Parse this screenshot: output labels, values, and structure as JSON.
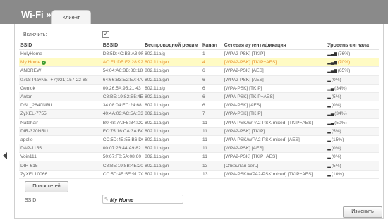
{
  "header": {
    "title": "Wi-Fi »",
    "tab": "Клиент"
  },
  "enable": {
    "label": "Включить:",
    "checked": true
  },
  "table": {
    "columns": [
      "SSID",
      "BSSID",
      "Беспроводной режим",
      "Канал",
      "Сетевая аутентификация",
      "Уровень сигнала"
    ],
    "rows": [
      {
        "ssid": "HolyHome",
        "bssid": "D8:5D:4C:B3:A3:9F",
        "mode": "802.11b/g",
        "channel": "1",
        "auth": "[WPA2-PSK] [TKIP]",
        "signal": "(76%)",
        "selected": false
      },
      {
        "ssid": "My Home",
        "bssid": "AC:F1:DF:F2:28:92",
        "mode": "802.11b/g/n",
        "channel": "4",
        "auth": "[WPA2-PSK] [TKIP+AES]",
        "signal": "(70%)",
        "selected": true
      },
      {
        "ssid": "ANDREW",
        "bssid": "54:04:A6:BB:8C:18",
        "mode": "802.11b/g/n",
        "channel": "6",
        "auth": "[WPA2-PSK] [AES]",
        "signal": "(65%)",
        "selected": false
      },
      {
        "ssid": "0798 PlayNET+7(921)157-22-88",
        "bssid": "64:66:B3:E2:E7:4A",
        "mode": "802.11b/g/n",
        "channel": "6",
        "auth": "[WPA2-PSK] [AES]",
        "signal": "(0%)",
        "selected": false
      },
      {
        "ssid": "Geniok",
        "bssid": "00:26:5A:95:21:43",
        "mode": "802.11b/g",
        "channel": "6",
        "auth": "[WPA-PSK] [TKIP]",
        "signal": "(34%)",
        "selected": false
      },
      {
        "ssid": "Anton",
        "bssid": "C8:BE:19:82:B5:4E",
        "mode": "802.11b/g/n",
        "channel": "6",
        "auth": "[WPA-PSK] [TKIP+AES]",
        "signal": "(5%)",
        "selected": false
      },
      {
        "ssid": "DSL_2640NRU",
        "bssid": "34:08:04:EC:24:68",
        "mode": "802.11b/g/n",
        "channel": "6",
        "auth": "[WPA-PSK] [AES]",
        "signal": "(0%)",
        "selected": false
      },
      {
        "ssid": "ZyXEL-7755",
        "bssid": "40:4A:03:AC:5A:B3",
        "mode": "802.11b/g/n",
        "channel": "7",
        "auth": "[WPA-PSK] [TKIP]",
        "signal": "(34%)",
        "selected": false
      },
      {
        "ssid": "Natahair",
        "bssid": "B0:48:7A:F5:B4:DC",
        "mode": "802.11b/g/n",
        "channel": "11",
        "auth": "[WPA-PSK/WPA2-PSK mixed] [TKIP+AES]",
        "signal": "(50%)",
        "selected": false
      },
      {
        "ssid": "DIR-320NRU",
        "bssid": "FC:75:16:CA:3A:BC",
        "mode": "802.11b/g/n",
        "channel": "11",
        "auth": "[WPA2-PSK] [TKIP]",
        "signal": "(5%)",
        "selected": false
      },
      {
        "ssid": "apollo",
        "bssid": "CC:5D:4E:55:B6:D0",
        "mode": "802.11b/g/n",
        "channel": "11",
        "auth": "[WPA-PSK/WPA2-PSK mixed] [AES]",
        "signal": "(15%)",
        "selected": false
      },
      {
        "ssid": "DAP-1155",
        "bssid": "00:07:26:44:A9:82",
        "mode": "802.11b/g/n",
        "channel": "11",
        "auth": "[WPA2-PSK] [AES]",
        "signal": "(0%)",
        "selected": false
      },
      {
        "ssid": "Voin111",
        "bssid": "50:67:F0:5A:08:60",
        "mode": "802.11b/g/n",
        "channel": "11",
        "auth": "[WPA2-PSK] [TKIP+AES]",
        "signal": "(0%)",
        "selected": false
      },
      {
        "ssid": "DIR-615",
        "bssid": "C8:BE:19:8B:4E:20",
        "mode": "802.11b/g/n",
        "channel": "13",
        "auth": "[Открытая сеть]",
        "signal": "(5%)",
        "selected": false
      },
      {
        "ssid": "ZyXEL10066",
        "bssid": "CC:5D:4E:5E:91:7C",
        "mode": "802.11b/g/n",
        "channel": "13",
        "auth": "[WPA-PSK/WPA2-PSK mixed] [TKIP+AES]",
        "signal": "(10%)",
        "selected": false
      }
    ]
  },
  "scan_button": "Поиск сетей",
  "ssid_field": {
    "label": "SSID:",
    "value": "My Home"
  },
  "change_button": "Изменить",
  "colors": {
    "header_bg": "#8a8a8a",
    "selected_row_bg": "#fffbc4",
    "selected_text": "#e8902a"
  },
  "icons": {
    "signal": "signal-bars-icon",
    "connected": "connected-check-icon",
    "nav": "left-arrow-icon"
  }
}
